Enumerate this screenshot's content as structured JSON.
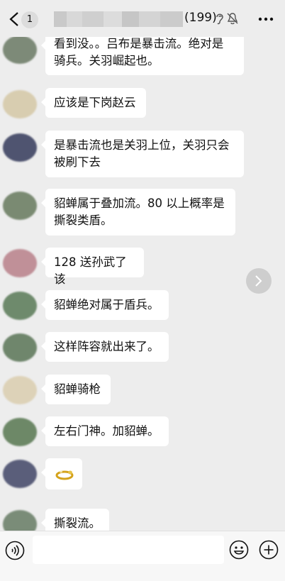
{
  "header": {
    "unread_count": "1",
    "member_count": "(199)"
  },
  "messages": [
    {
      "text": "看到没。。吕布是暴击流。绝对是\n骑兵。关羽崛起也。",
      "avatar_color": "#7d8a78"
    },
    {
      "text": "应该是下岗赵云",
      "avatar_color": "#d8cdb0"
    },
    {
      "text": "是暴击流也是关羽上位，关羽只会\n被刷下去",
      "avatar_color": "#4f5470"
    },
    {
      "text": "貂蝉属于叠加流。80 以上概率是\n撕裂类盾。",
      "avatar_color": "#7a8a72"
    },
    {
      "text": "128 送孙武了该",
      "avatar_color": "#c09098"
    },
    {
      "text": "貂蝉绝对属于盾兵。",
      "avatar_color": "#6e8a6c"
    },
    {
      "text": "这样阵容就出来了。",
      "avatar_color": "#6f866c"
    },
    {
      "text": "貂蝉骑枪",
      "avatar_color": "#ddd2b8"
    },
    {
      "text": "左右门神。加貂蝉。",
      "avatar_color": "#6d8867"
    },
    {
      "text": "",
      "avatar_color": "#5a5e7a",
      "sticker": "ring-emoji"
    },
    {
      "text": "撕裂流。",
      "avatar_color": "#7a8c78"
    }
  ],
  "input": {
    "value": ""
  },
  "colors": {
    "background": "#ededed",
    "bubble": "#ffffff"
  }
}
